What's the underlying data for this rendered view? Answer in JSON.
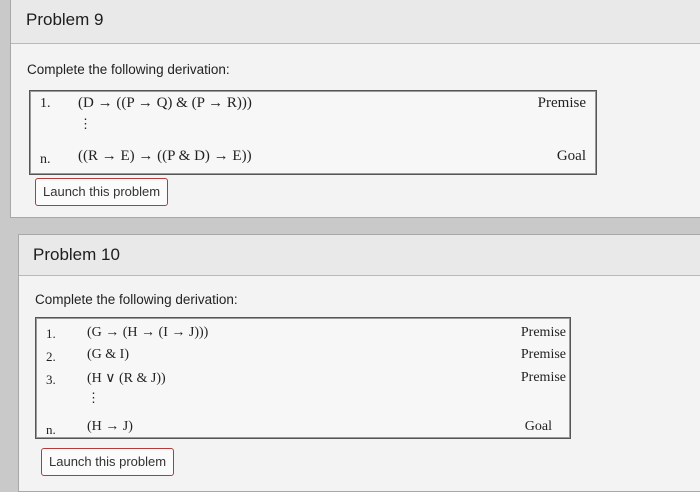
{
  "problems": [
    {
      "title": "Problem 9",
      "instruction": "Complete the following derivation:",
      "lines": [
        {
          "num": "1.",
          "formula": "(D → ((P → Q) & (P → R)))",
          "just": "Premise"
        },
        {
          "num": "n.",
          "formula": "((R → E) → ((P & D) → E))",
          "just": "Goal"
        }
      ],
      "ellipsis": "⋮",
      "launch_label": "Launch this problem"
    },
    {
      "title": "Problem 10",
      "instruction": "Complete the following derivation:",
      "lines": [
        {
          "num": "1.",
          "formula": "(G → (H → (I → J)))",
          "just": "Premise"
        },
        {
          "num": "2.",
          "formula": "(G & I)",
          "just": "Premise"
        },
        {
          "num": "3.",
          "formula": "(H ∨ (R & J))",
          "just": "Premise"
        },
        {
          "num": "n.",
          "formula": "(H → J)",
          "just": "Goal"
        }
      ],
      "ellipsis": "⋮",
      "launch_label": "Launch this problem"
    }
  ],
  "colors": {
    "page_bg": "#c9c9c9",
    "card_bg": "#f3f3f3",
    "header_bg": "#e9e9e9",
    "launch_border": "#b43a3a"
  }
}
